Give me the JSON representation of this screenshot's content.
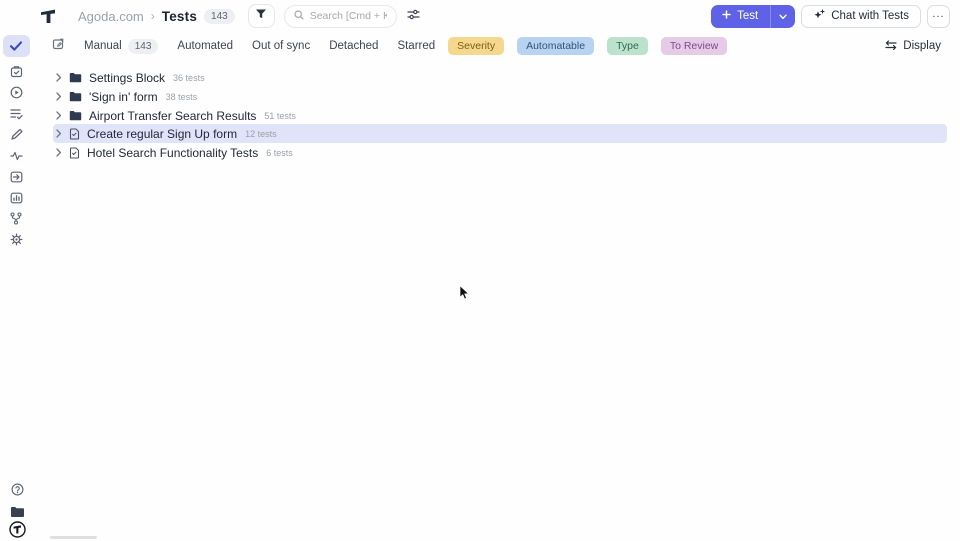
{
  "header": {
    "breadcrumb": {
      "project": "Agoda.com",
      "separator": "›",
      "page": "Tests",
      "count": "143"
    },
    "search": {
      "placeholder": "Search [Cmd + K]"
    },
    "test_button": {
      "label": "Test"
    },
    "chat_button": {
      "label": "Chat with Tests"
    },
    "more_label": "..."
  },
  "filterbar": {
    "tabs": [
      {
        "label": "Manual",
        "count": "143"
      },
      {
        "label": "Automated"
      },
      {
        "label": "Out of sync"
      },
      {
        "label": "Detached"
      },
      {
        "label": "Starred"
      }
    ],
    "badges": [
      {
        "label": "Severity",
        "bg": "#f5d78e",
        "fg": "#7c5f16"
      },
      {
        "label": "Automatable",
        "bg": "#b7d3f1",
        "fg": "#32557b"
      },
      {
        "label": "Type",
        "bg": "#bce1cd",
        "fg": "#2f6b4e"
      },
      {
        "label": "To Review",
        "bg": "#e6cbe9",
        "fg": "#7c4d86"
      }
    ],
    "display_label": "Display"
  },
  "tree": {
    "rows": [
      {
        "icon": "folder",
        "label": "Settings Block",
        "count": "36 tests",
        "selected": false
      },
      {
        "icon": "folder",
        "label": "'Sign in' form",
        "count": "38 tests",
        "selected": false
      },
      {
        "icon": "folder",
        "label": "Airport Transfer Search Results",
        "count": "51 tests",
        "selected": false
      },
      {
        "icon": "file",
        "label": "Create regular Sign Up form",
        "count": "12 tests",
        "selected": true
      },
      {
        "icon": "file",
        "label": "Hotel Search Functionality Tests",
        "count": "6 tests",
        "selected": false
      }
    ]
  },
  "sidebar": {
    "top_items": [
      "check-icon",
      "clipboard-check-icon",
      "play-circle-icon",
      "list-check-icon",
      "pen-icon",
      "pulse-icon",
      "import-box-icon",
      "chart-box-icon",
      "branch-icon",
      "gear-icon"
    ],
    "bottom_items": [
      "help-circle-icon",
      "folder-icon",
      "logo-circle-icon"
    ]
  },
  "colors": {
    "accent": "#5f61e6",
    "row_highlight": "#dfe4f9",
    "active_sidebar_bg": "#dce1f8",
    "count_pill_bg": "#edeff2"
  }
}
